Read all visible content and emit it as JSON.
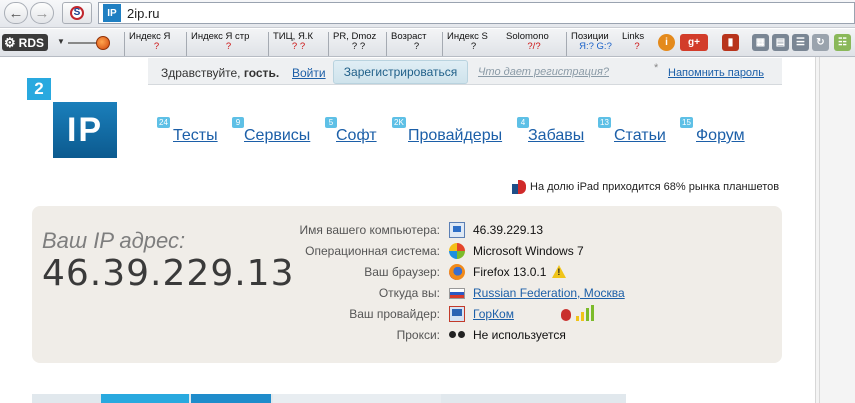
{
  "browser": {
    "url": "2ip.ru",
    "site_icon": "IP",
    "stop_icon": "S"
  },
  "seo_toolbar": {
    "rds_label": "RDS",
    "items": [
      {
        "label": "Индекс Я",
        "value": "?"
      },
      {
        "label": "Индекс Я стр",
        "value": "?"
      },
      {
        "label": "ТИЦ, Я.К",
        "value": "? ?"
      },
      {
        "label": "PR, Dmoz",
        "value": "? ?"
      },
      {
        "label": "Возраст",
        "value": "?"
      },
      {
        "label": "Индекс S",
        "value": "?"
      },
      {
        "label": "Solomono",
        "value": "?/?"
      },
      {
        "label": "Позиции",
        "value": "Я:? G:?"
      },
      {
        "label": "Links",
        "value": "?"
      }
    ],
    "colors": {
      "question": "#cc1111",
      "google": "#1a61c8"
    }
  },
  "auth": {
    "greeting_prefix": "Здравствуйте,",
    "greeting_user": "гость.",
    "login": "Войти",
    "register": "Зарегистрироваться",
    "why_register": "Что дает регистрация?",
    "star": "*",
    "remind_password": "Напомнить пароль"
  },
  "logo": {
    "top": "2",
    "main": "IP"
  },
  "menu": [
    {
      "count": "24",
      "label": "Тесты"
    },
    {
      "count": "9",
      "label": "Сервисы"
    },
    {
      "count": "5",
      "label": "Софт"
    },
    {
      "count": "2K",
      "label": "Провайдеры"
    },
    {
      "count": "4",
      "label": "Забавы"
    },
    {
      "count": "13",
      "label": "Статьи"
    },
    {
      "count": "15",
      "label": "Форум"
    }
  ],
  "news": "На долю iPad приходится 68% рынка планшетов",
  "ip_panel": {
    "title": "Ваш IP адрес:",
    "ip": "46.39.229.13",
    "rows": [
      {
        "label": "Имя вашего компьютера:",
        "value": "46.39.229.13",
        "icon": "monitor-icon"
      },
      {
        "label": "Операционная система:",
        "value": "Microsoft Windows 7",
        "icon": "windows-icon"
      },
      {
        "label": "Ваш браузер:",
        "value": "Firefox 13.0.1",
        "icon": "firefox-icon"
      },
      {
        "label": "Откуда вы:",
        "value": "Russian Federation, Москва",
        "icon": "russia-flag-icon"
      },
      {
        "label": "Ваш провайдер:",
        "value": "ГорКом",
        "icon": "isp-icon"
      },
      {
        "label": "Прокси:",
        "value": "Не используется",
        "icon": "glasses-icon"
      }
    ],
    "warning_mark": "!"
  },
  "colors": {
    "link": "#1c5fa8",
    "logo_blue": "#1a7fbb",
    "logo_light": "#29a9df",
    "panel_bg": "#f0ede8",
    "badge": "#5ec0e6"
  }
}
